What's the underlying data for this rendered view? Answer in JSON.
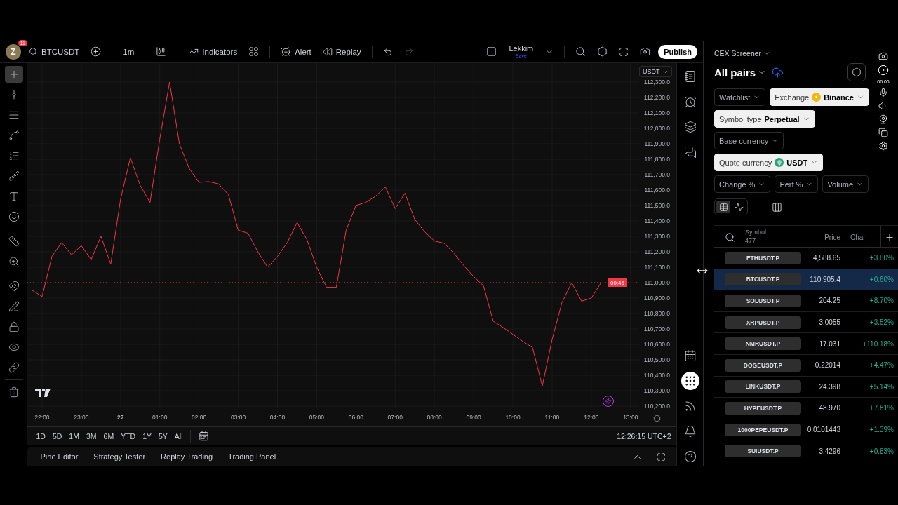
{
  "top_bar": {
    "avatar": "Z",
    "notifications": "11",
    "symbol": "BTCUSDT",
    "interval": "1m",
    "indicators": "Indicators",
    "alert": "Alert",
    "replay": "Replay",
    "layout_name": "Lekkim",
    "layout_status": "Save",
    "publish": "Publish"
  },
  "drawing_tools": [
    {
      "selected": true
    },
    {
      "selected": false
    },
    {
      "selected": false
    },
    {
      "selected": false
    },
    {
      "selected": false
    },
    {
      "selected": false
    },
    {
      "selected": false
    },
    {
      "selected": false
    },
    {
      "selected": false
    },
    {
      "selected": false
    },
    {
      "selected": false
    },
    {
      "selected": false
    },
    {
      "selected": false
    },
    {
      "selected": false
    },
    {
      "selected": false
    },
    {
      "selected": false
    }
  ],
  "chart": {
    "currency": "USDT",
    "countdown": "00:45",
    "chart_data": {
      "type": "line",
      "categories": [
        null,
        "22:00",
        null,
        null,
        null,
        "23:00",
        null,
        null,
        null,
        "27",
        null,
        null,
        null,
        "01:00",
        null,
        null,
        null,
        "02:00",
        null,
        null,
        null,
        "03:00",
        null,
        null,
        null,
        "04:00",
        null,
        null,
        null,
        "05:00",
        null,
        null,
        null,
        "06:00",
        null,
        null,
        null,
        "07:00",
        null,
        null,
        null,
        "08:00",
        null,
        null,
        null,
        "09:00",
        null,
        null,
        null,
        "10:00",
        null,
        null,
        null,
        "11:00",
        null,
        null,
        null,
        "12:00",
        null,
        null,
        null,
        "13:00"
      ],
      "series": [
        {
          "color": "#f23645",
          "values": [
            110950,
            110910,
            111170,
            111260,
            111180,
            111240,
            111150,
            111300,
            111120,
            111540,
            111810,
            111630,
            111520,
            111930,
            112300,
            111900,
            111740,
            111650,
            111655,
            111640,
            111570,
            111340,
            111320,
            111200,
            111100,
            111170,
            111260,
            111390,
            111280,
            111100,
            110970,
            110970,
            111340,
            111500,
            111520,
            111560,
            111620,
            111480,
            111580,
            111410,
            111330,
            111270,
            111255,
            111190,
            111110,
            111040,
            110980,
            110750,
            110710,
            110665,
            110620,
            110580,
            110330,
            110630,
            110870,
            111000,
            110880,
            110900,
            111000,
            null,
            null,
            null
          ]
        }
      ],
      "ylim": [
        110200,
        112300
      ],
      "grid": true,
      "ref_lines": [
        {
          "axis": "y",
          "value": 111000,
          "color": "#f23645"
        }
      ],
      "yticks": [
        {
          "value": 112300,
          "label": "112,300.0"
        },
        {
          "value": 112200,
          "label": "112,200.0"
        },
        {
          "value": 112100,
          "label": "112,100.0"
        },
        {
          "value": 112000,
          "label": "112,000.0"
        },
        {
          "value": 111900,
          "label": "111,900.0"
        },
        {
          "value": 111800,
          "label": "111,800.0"
        },
        {
          "value": 111700,
          "label": "111,700.0"
        },
        {
          "value": 111600,
          "label": "111,600.0"
        },
        {
          "value": 111500,
          "label": "111,500.0"
        },
        {
          "value": 111400,
          "label": "111,400.0"
        },
        {
          "value": 111300,
          "label": "111,300.0"
        },
        {
          "value": 111200,
          "label": "111,200.0"
        },
        {
          "value": 111100,
          "label": "111,100.0"
        },
        {
          "value": 111000,
          "label": "111,000.0"
        },
        {
          "value": 110900,
          "label": "110,900.0"
        },
        {
          "value": 110800,
          "label": "110,800.0"
        },
        {
          "value": 110700,
          "label": "110,700.0"
        },
        {
          "value": 110600,
          "label": "110,600.0"
        },
        {
          "value": 110500,
          "label": "110,500.0"
        },
        {
          "value": 110400,
          "label": "110,400.0"
        },
        {
          "value": 110300,
          "label": "110,300.0"
        },
        {
          "value": 110200,
          "label": "110,200.0"
        }
      ]
    }
  },
  "ranges": [
    "1D",
    "5D",
    "1M",
    "3M",
    "6M",
    "YTD",
    "1Y",
    "5Y",
    "All"
  ],
  "clock": "12:26:15 UTC+2",
  "bottom_tabs": [
    "Pine Editor",
    "Strategy Tester",
    "Replay Trading",
    "Trading Panel"
  ],
  "right_icons": [
    {
      "selected": false
    },
    {
      "selected": false
    },
    {
      "selected": false
    },
    {
      "selected": false
    },
    {
      "selected": false
    },
    {
      "selected": true
    },
    {
      "selected": false
    },
    {
      "selected": false
    },
    {
      "selected": false
    }
  ],
  "recorder": {
    "timer": "06:06"
  },
  "screener": {
    "title": "CEX Screener",
    "list": "All pairs",
    "filters": [
      {
        "kind": "plain",
        "label": "Watchlist",
        "active": false
      },
      {
        "kind": "exchange",
        "label": "Exchange",
        "value": "Binance",
        "active": true
      },
      {
        "kind": "plain",
        "label": "Symbol type",
        "value": "Perpetual",
        "active": true
      },
      {
        "kind": "plain",
        "label": "Base currency",
        "active": false
      },
      {
        "kind": "coin",
        "label": "Quote currency",
        "value": "USDT",
        "active": true
      },
      {
        "kind": "plain",
        "label": "Change %",
        "active": false
      },
      {
        "kind": "plain",
        "label": "Perf %",
        "active": false
      },
      {
        "kind": "plain",
        "label": "Volume",
        "active": false
      }
    ],
    "view_modes": [
      {
        "selected": true
      },
      {
        "selected": false
      }
    ],
    "columns": {
      "symbol": "Symbol",
      "count": "477",
      "price": "Price",
      "change": "Char"
    },
    "rows": [
      {
        "symbol": "ETHUSDT.P",
        "price": "4,588.65",
        "change": "+3.80%",
        "selected": false
      },
      {
        "symbol": "BTCUSDT.P",
        "price": "110,905.4",
        "change": "+0.60%",
        "selected": true
      },
      {
        "symbol": "SOLUSDT.P",
        "price": "204.25",
        "change": "+8.70%",
        "selected": false
      },
      {
        "symbol": "XRPUSDT.P",
        "price": "3.0055",
        "change": "+3.52%",
        "selected": false
      },
      {
        "symbol": "NMRUSDT.P",
        "price": "17.031",
        "change": "+110.18%",
        "selected": false
      },
      {
        "symbol": "DOGEUSDT.P",
        "price": "0.22014",
        "change": "+4.47%",
        "selected": false
      },
      {
        "symbol": "LINKUSDT.P",
        "price": "24.398",
        "change": "+5.14%",
        "selected": false
      },
      {
        "symbol": "HYPEUSDT.P",
        "price": "48.970",
        "change": "+7.81%",
        "selected": false
      },
      {
        "symbol": "1000PEPEUSDT.P",
        "price": "0.0101443",
        "change": "+1.39%",
        "selected": false
      },
      {
        "symbol": "SUIUSDT.P",
        "price": "3.4296",
        "change": "+0.83%",
        "selected": false
      }
    ]
  }
}
